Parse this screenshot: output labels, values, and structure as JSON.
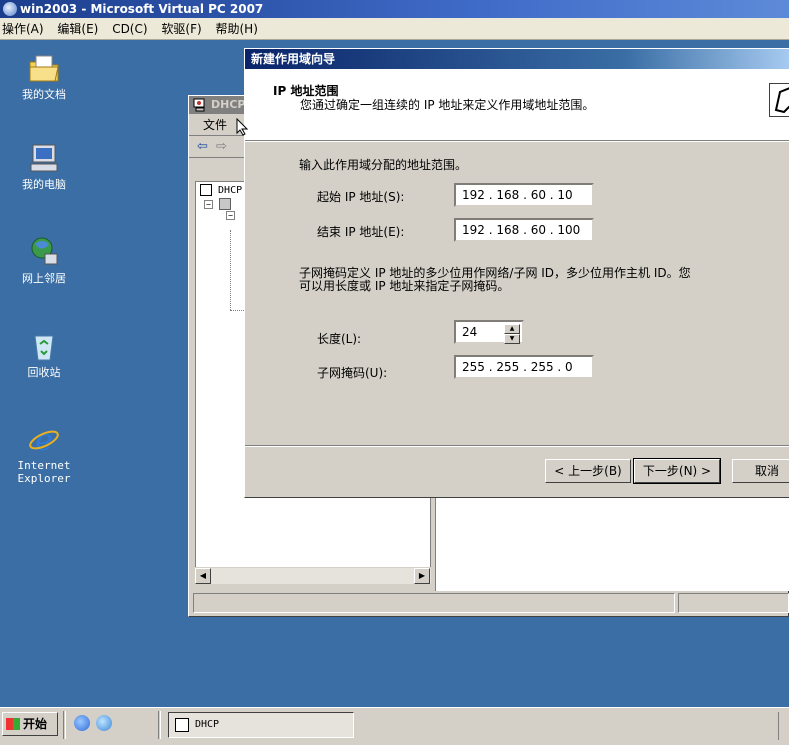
{
  "host": {
    "title": "win2003 - Microsoft Virtual PC 2007",
    "menu": [
      "操作(A)",
      "编辑(E)",
      "CD(C)",
      "软驱(F)",
      "帮助(H)"
    ]
  },
  "desktop": {
    "icons": [
      {
        "label": "我的文档",
        "icon": "my-documents-icon"
      },
      {
        "label": "我的电脑",
        "icon": "my-computer-icon"
      },
      {
        "label": "网上邻居",
        "icon": "network-places-icon"
      },
      {
        "label": "回收站",
        "icon": "recycle-bin-icon"
      },
      {
        "label": "Internet Explorer",
        "icon": "internet-explorer-icon"
      }
    ]
  },
  "mmc": {
    "title": "DHCP",
    "menu_file": "文件",
    "tree_root": "DHCP",
    "nav_back": "⇦",
    "nav_forward": "⇨"
  },
  "wizard": {
    "title": "新建作用域向导",
    "header_title": "IP 地址范围",
    "header_subtitle": "您通过确定一组连续的 IP 地址来定义作用域地址范围。",
    "prompt": "输入此作用域分配的地址范围。",
    "start_label": "起始 IP 地址(S):",
    "start_value": "192 . 168 . 60 . 10",
    "end_label": "结束 IP 地址(E):",
    "end_value": "192 . 168 . 60 . 100",
    "mask_desc_1": "子网掩码定义 IP 地址的多少位用作网络/子网 ID，多少位用作主机 ID。您",
    "mask_desc_2": "可以用长度或 IP 地址来指定子网掩码。",
    "length_label": "长度(L):",
    "length_value": "24",
    "mask_label": "子网掩码(U):",
    "mask_value": "255 . 255 . 255 . 0",
    "back_button": "< 上一步(B)",
    "next_button": "下一步(N) >",
    "cancel_button": "取消"
  },
  "taskbar": {
    "start_label": "开始",
    "task_dhcp": "DHCP"
  }
}
